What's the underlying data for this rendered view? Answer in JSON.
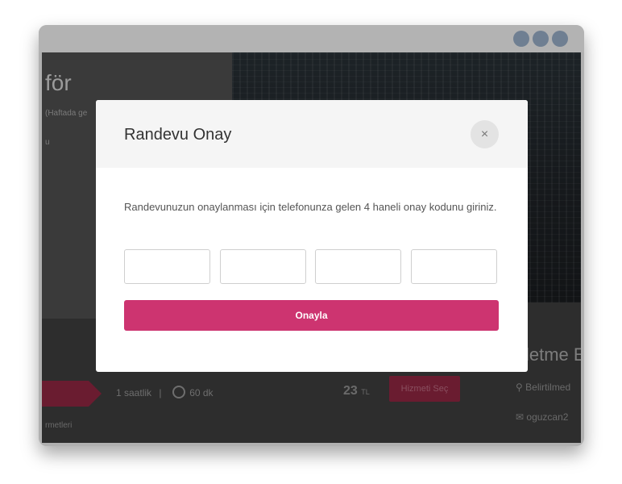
{
  "window": {
    "control_icons": [
      "circle-icon",
      "circle-icon",
      "circle-icon"
    ]
  },
  "background_page": {
    "title": "för",
    "subtitle": "(Haftada ge",
    "side_text": "u",
    "right_title": "letme E",
    "service_row": {
      "duration_label": "1 saatlik",
      "separator": "|",
      "minutes": "60 dk",
      "price": "23",
      "currency": "TL",
      "select_button": "Hizmeti Seç"
    },
    "location": "Belirtilmed",
    "email": "oguzcan2",
    "footer_text": "rmetleri"
  },
  "modal": {
    "title": "Randevu Onay",
    "close_icon": "×",
    "message": "Randevunuzun onaylanması için telefonunza gelen 4 haneli onay kodunu giriniz.",
    "code_inputs": [
      "",
      "",
      "",
      ""
    ],
    "confirm_label": "Onayla",
    "accent_color": "#cd3470"
  }
}
